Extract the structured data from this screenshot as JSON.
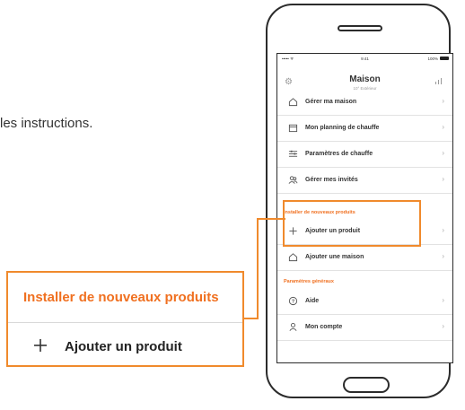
{
  "intro": {
    "text": "les instructions."
  },
  "phone": {
    "status_bar": {
      "signal": "•••••  ᯤ",
      "time": "9:41",
      "battery": "100%"
    },
    "header": {
      "title": "Maison",
      "subtitle": "10° Extérieur",
      "left_icon": "gear-icon",
      "right_icon": "bar-chart-icon"
    },
    "menu": [
      {
        "label": "Gérer ma maison",
        "icon": "home-icon"
      },
      {
        "label": "Mon planning de chauffe",
        "icon": "calendar-icon"
      },
      {
        "label": "Paramètres de chauffe",
        "icon": "sliders-icon"
      },
      {
        "label": "Gérer mes invités",
        "icon": "users-icon"
      }
    ],
    "section_install": "Installer de nouveaux produits",
    "install_items": [
      {
        "label": "Ajouter un produit",
        "icon": "plus-icon"
      },
      {
        "label": "Ajouter une maison",
        "icon": "home-icon"
      }
    ],
    "section_general": "Paramètres généraux",
    "general_items": [
      {
        "label": "Aide",
        "icon": "help-icon"
      },
      {
        "label": "Mon compte",
        "icon": "user-icon"
      }
    ],
    "chevron": "›"
  },
  "callout": {
    "header": "Installer de nouveaux produits",
    "item_label": "Ajouter un produit"
  },
  "colors": {
    "accent": "#f07020",
    "highlight_border": "#f08a2c",
    "divider": "#e2e2e2"
  }
}
